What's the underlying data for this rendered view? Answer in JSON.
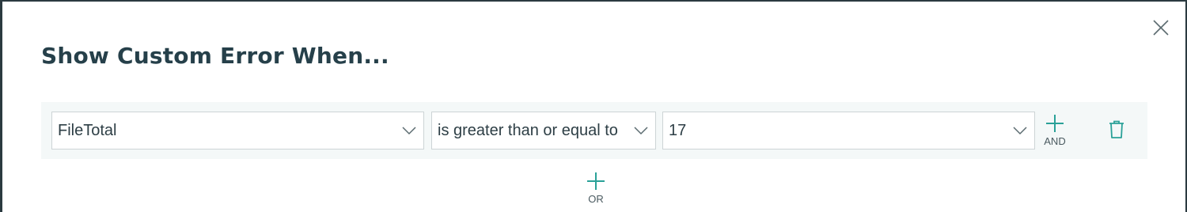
{
  "dialog": {
    "title": "Show Custom Error When...",
    "close_icon": "close-icon"
  },
  "condition": {
    "field": "FileTotal",
    "operator": "is greater than or equal to",
    "value": "17",
    "dropdown_icon": "chevron-down-icon",
    "and_label": "AND",
    "delete_icon": "trash-icon"
  },
  "or_label": "OR",
  "colors": {
    "accent": "#2aa198",
    "title": "#26404a",
    "row_background": "#f4f8f8"
  }
}
